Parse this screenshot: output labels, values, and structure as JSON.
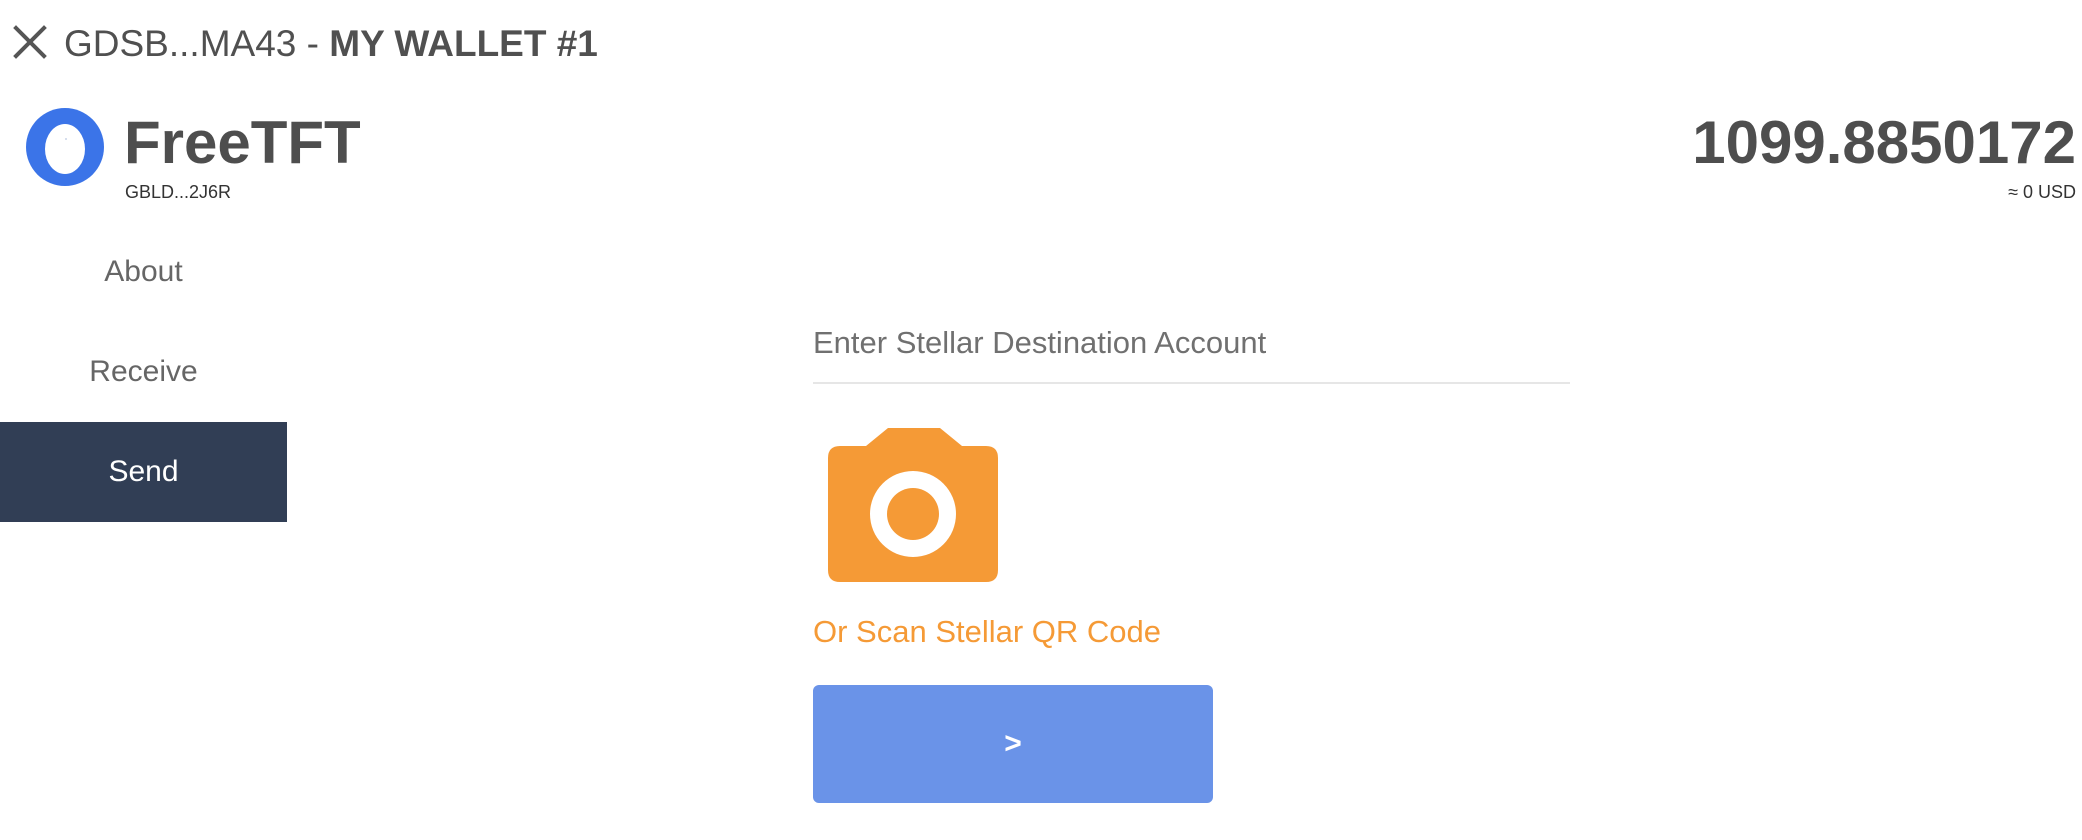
{
  "header": {
    "close_icon": "close-icon",
    "account_short": "GDSB...MA43",
    "separator": " - ",
    "wallet_name": "MY WALLET #1"
  },
  "asset": {
    "logo_icon": "asset-logo-icon",
    "logo_color": "#3b74e8",
    "name": "FreeTFT",
    "issuer_short": "GBLD...2J6R",
    "balance": "1099.8850172",
    "fiat_value": "≈ 0 USD"
  },
  "nav": {
    "items": [
      {
        "label": "About",
        "active": false
      },
      {
        "label": "Receive",
        "active": false
      },
      {
        "label": "Send",
        "active": true
      }
    ],
    "active_bg": "#313e55"
  },
  "send": {
    "destination_placeholder": "Enter Stellar Destination Account",
    "destination_value": "",
    "camera_icon": "camera-icon",
    "camera_color": "#f59a36",
    "scan_label": "Or Scan Stellar QR Code",
    "next_label": ">",
    "next_color": "#6a93e8"
  }
}
